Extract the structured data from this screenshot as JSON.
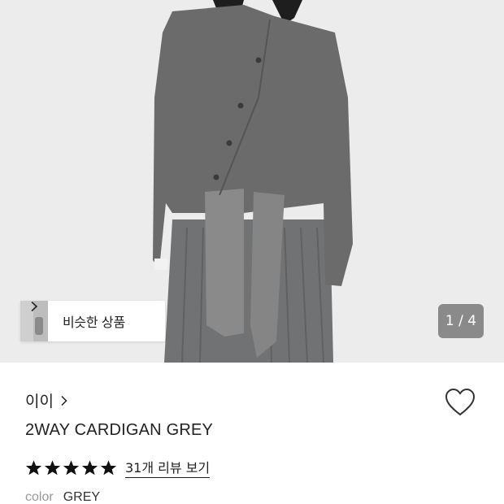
{
  "hero": {
    "similar_label": "비슷한 상품",
    "pager": "1 / 4"
  },
  "product": {
    "brand": "이이",
    "title": "2WAY CARDIGAN GREY",
    "rating_stars": 5,
    "review_link": "31개 리뷰 보기",
    "color_label": "color",
    "color_value": "GREY"
  },
  "icons": {
    "wishlist": "heart-icon",
    "brand_arrow": "chevron-right-icon",
    "similar_arrow": "chevron-right-icon",
    "star": "star-icon"
  },
  "colors": {
    "cardigan": "#6b6b6b",
    "skirt": "#707273",
    "background": "#ececec"
  }
}
